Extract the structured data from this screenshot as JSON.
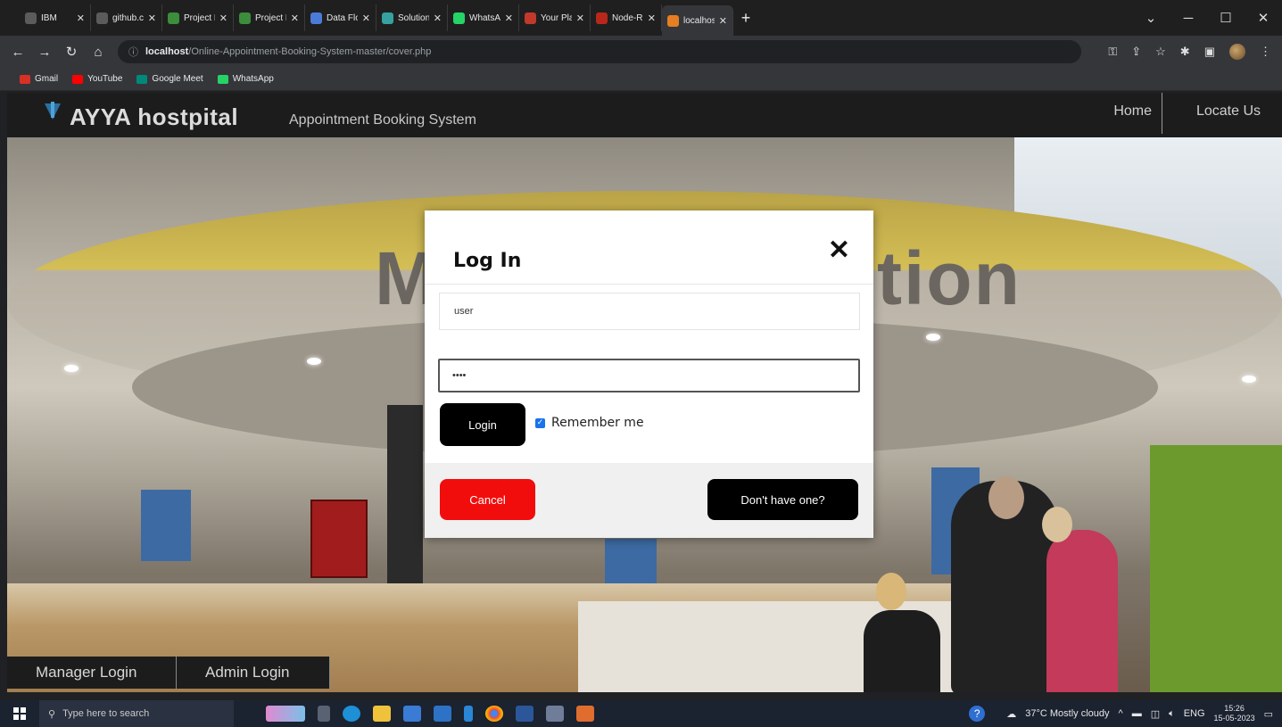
{
  "browser": {
    "tabs": [
      {
        "title": "IBM",
        "fav_color": "#5b5b5b"
      },
      {
        "title": "github.com",
        "fav_color": "#5b5b5b"
      },
      {
        "title": "Project De",
        "fav_color": "#3c8d3c"
      },
      {
        "title": "Project Do",
        "fav_color": "#3c8d3c"
      },
      {
        "title": "Data Flow",
        "fav_color": "#4a7bd6"
      },
      {
        "title": "Solution F",
        "fav_color": "#37a0a0"
      },
      {
        "title": "WhatsApp",
        "fav_color": "#25d366"
      },
      {
        "title": "Your Platfo",
        "fav_color": "#c0392b"
      },
      {
        "title": "Node-RED",
        "fav_color": "#b7281a"
      },
      {
        "title": "localhost/",
        "fav_color": "#e67e22"
      }
    ],
    "new_tab": "+",
    "address": {
      "host": "localhost",
      "path": "/Online-Appointment-Booking-System-master/cover.php"
    },
    "bookmarks": [
      {
        "label": "Gmail",
        "color": "#d93025"
      },
      {
        "label": "YouTube",
        "color": "#ff0000"
      },
      {
        "label": "Google Meet",
        "color": "#00897b"
      },
      {
        "label": "WhatsApp",
        "color": "#25d366"
      }
    ]
  },
  "site": {
    "brand": "AYYA hostpital",
    "tagline": "Appointment Booking System",
    "nav": {
      "home": "Home",
      "locate": "Locate Us"
    },
    "hero_letters_left": "M",
    "hero_letters_right": "tion",
    "bottom_links": {
      "manager": "Manager Login",
      "admin": "Admin Login"
    }
  },
  "modal": {
    "title": "Log In",
    "close": "✕",
    "username_value": "user",
    "password_value": "••••",
    "login_label": "Login",
    "remember_label": "Remember me",
    "remember_checked": true,
    "cancel_label": "Cancel",
    "signup_label": "Don't have one?"
  },
  "taskbar": {
    "search_placeholder": "Type here to search",
    "weather": "37°C  Mostly cloudy",
    "lang": "ENG",
    "time": "15:26",
    "date": "15-05-2023"
  },
  "colors": {
    "cancel": "#f20d0d",
    "primary_btn": "#000000",
    "checkbox": "#1a73e8"
  }
}
